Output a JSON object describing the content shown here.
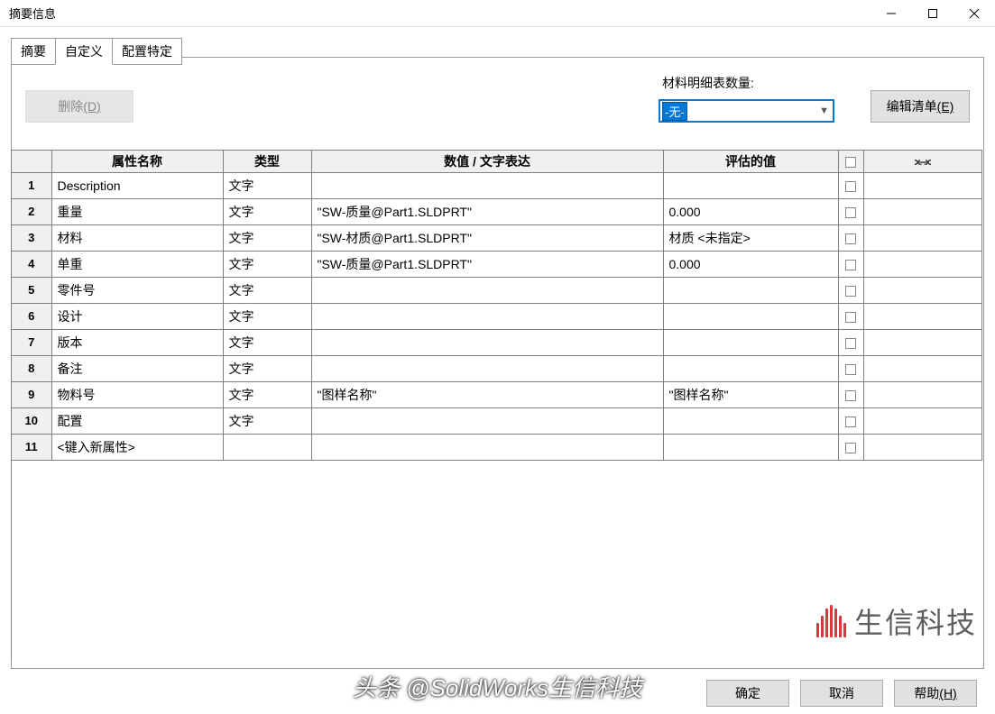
{
  "window": {
    "title": "摘要信息"
  },
  "tabs": {
    "summary": "摘要",
    "custom": "自定义",
    "config": "配置特定"
  },
  "toolbar": {
    "delete_label": "删除",
    "delete_key": "(D)",
    "bom_label": "材料明细表数量:",
    "bom_value": "-无-",
    "edit_list_label": "编辑清单",
    "edit_list_key": "(E)"
  },
  "headers": {
    "propname": "属性名称",
    "type": "类型",
    "expr": "数值 / 文字表达",
    "eval": "评估的值"
  },
  "rows": [
    {
      "n": "1",
      "name": "Description",
      "type": "文字",
      "expr": "",
      "eval": ""
    },
    {
      "n": "2",
      "name": "重量",
      "type": "文字",
      "expr": "\"SW-质量@Part1.SLDPRT\"",
      "eval": "0.000"
    },
    {
      "n": "3",
      "name": "材料",
      "type": "文字",
      "expr": "\"SW-材质@Part1.SLDPRT\"",
      "eval": "材质 <未指定>"
    },
    {
      "n": "4",
      "name": "单重",
      "type": "文字",
      "expr": "\"SW-质量@Part1.SLDPRT\"",
      "eval": "0.000"
    },
    {
      "n": "5",
      "name": "零件号",
      "type": "文字",
      "expr": "",
      "eval": ""
    },
    {
      "n": "6",
      "name": "设计",
      "type": "文字",
      "expr": "",
      "eval": ""
    },
    {
      "n": "7",
      "name": "版本",
      "type": "文字",
      "expr": "",
      "eval": ""
    },
    {
      "n": "8",
      "name": "备注",
      "type": "文字",
      "expr": "",
      "eval": ""
    },
    {
      "n": "9",
      "name": "物料号",
      "type": "文字",
      "expr": "\"图样名称\"",
      "eval": "\"图样名称\""
    },
    {
      "n": "10",
      "name": "配置",
      "type": "文字",
      "expr": "",
      "eval": ""
    },
    {
      "n": "11",
      "name": "<键入新属性>",
      "type": "",
      "expr": "",
      "eval": ""
    }
  ],
  "buttons": {
    "ok": "确定",
    "cancel": "取消",
    "help": "帮助",
    "help_key": "(H)"
  },
  "watermark": {
    "brand": "生信科技",
    "credit": "头条 @SolidWorks生信科技"
  }
}
